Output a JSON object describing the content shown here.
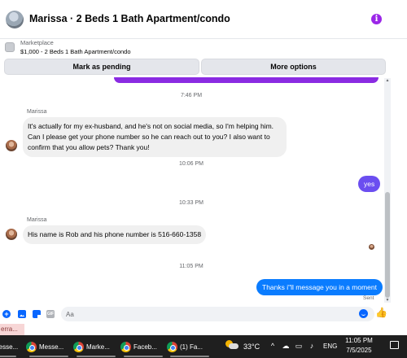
{
  "header": {
    "title": "Marissa · 2 Beds 1 Bath Apartment/condo",
    "info_icon": "i"
  },
  "marketplace": {
    "label": "Marketplace",
    "listing": "$1,000 - 2 Beds 1 Bath Apartment/condo",
    "buttons": {
      "pending": "Mark as pending",
      "more": "More options"
    }
  },
  "messages": {
    "ts1": "7:46 PM",
    "sender1": "Marissa",
    "msg1": "It's actually for my ex-husband, and he's not on social media, so I'm helping him. Can I please get your phone number so he can reach out to you? I also want to confirm that you allow pets? Thank you!",
    "ts2": "10:06 PM",
    "yes": "yes",
    "ts3": "10:33 PM",
    "sender2": "Marissa",
    "msg2": "His name is Rob and his phone number is 516-660-1358",
    "ts4": "11:05 PM",
    "reply": "Thanks i\"ll message you in a moment",
    "sent": "Sent"
  },
  "composer": {
    "placeholder": "Aa",
    "plus_icon": "+",
    "gif_icon": "GIF",
    "like_icon": "👍"
  },
  "notification": {
    "text": "erra..."
  },
  "taskbar": {
    "apps": [
      "Messe...",
      "Marke...",
      "Faceb...",
      "(1) Fa..."
    ],
    "temperature": "33°C",
    "tray": {
      "chevron": "^",
      "language": "ENG"
    },
    "time": "11:05 PM",
    "date": "7/5/2025"
  },
  "colors": {
    "outgoing_bubble": "#0a7cff",
    "yes_bubble": "#6b4ef0",
    "accent": "#0866ff",
    "info_icon": "#9b26e8"
  }
}
